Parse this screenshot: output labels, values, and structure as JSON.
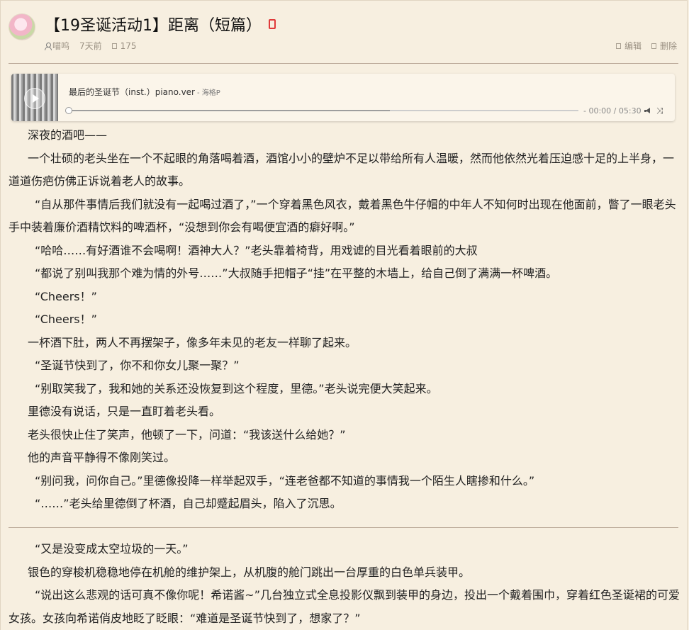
{
  "post": {
    "title": "【19圣诞活动1】距离（短篇）",
    "author": "喵呜",
    "time": "7天前",
    "views": "175",
    "edit_label": "编辑",
    "delete_label": "删除"
  },
  "player": {
    "song": "最后的圣诞节（inst.）piano.ver",
    "artist": "- 海格P",
    "time": "- 00:00 / 05:30",
    "progress_loaded": 0.63
  },
  "section1": [
    "深夜的酒吧——",
    "一个壮硕的老头坐在一个不起眼的角落喝着酒，酒馆小小的壁炉不足以带给所有人温暖，然而他依然光着压迫感十足的上半身，一道道伤疤仿佛正诉说着老人的故事。",
    "“自从那件事情后我们就没有一起喝过酒了，”一个穿着黑色风衣，戴着黑色牛仔帽的中年人不知何时出现在他面前，瞥了一眼老头手中装着廉价酒精饮料的啤酒杯，“没想到你会有喝便宜酒的癖好啊。”",
    "“哈哈……有好酒谁不会喝啊！酒神大人？”老头靠着椅背，用戏谑的目光看着眼前的大叔",
    "“都说了别叫我那个难为情的外号……”大叔随手把帽子“挂”在平整的木墙上，给自己倒了满满一杯啤酒。",
    "“Cheers！”",
    "“Cheers！”",
    "一杯酒下肚，两人不再摆架子，像多年未见的老友一样聊了起来。",
    "“圣诞节快到了，你不和你女儿聚一聚？”",
    "“别取笑我了，我和她的关系还没恢复到这个程度，里德。”老头说完便大笑起来。",
    "里德没有说话，只是一直盯着老头看。",
    "老头很快止住了笑声，他顿了一下，问道：“我该送什么给她？”",
    "他的声音平静得不像刚笑过。",
    "“别问我，问你自己。”里德像投降一样举起双手，“连老爸都不知道的事情我一个陌生人瞎掺和什么。”",
    "“……”老头给里德倒了杯酒，自己却蹙起眉头，陷入了沉思。"
  ],
  "section2": [
    "“又是没变成太空垃圾的一天。”",
    "银色的穿梭机稳稳地停在机舱的维护架上，从机腹的舱门跳出一台厚重的白色单兵装甲。",
    "“说出这么悲观的话可真不像你呢！希诺酱~”几台独立式全息投影仪飘到装甲的身边，投出一个戴着围巾，穿着红色圣诞裙的可爱女孩。女孩向希诺俏皮地眨了眨眼：“难道是圣诞节快到了，想家了？”"
  ],
  "colors": {
    "background": "#f7efe0",
    "divider": "#b9a897",
    "lock": "#e03a3a"
  }
}
